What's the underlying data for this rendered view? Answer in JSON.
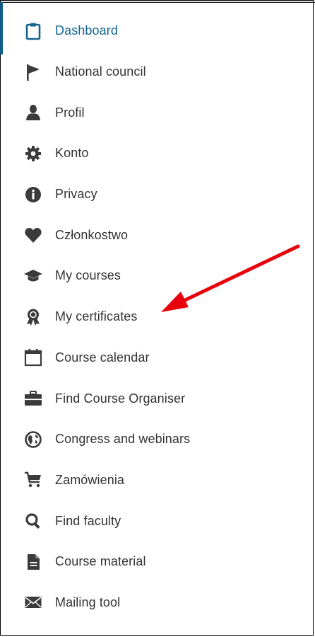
{
  "menu": {
    "items": [
      {
        "label": "Dashboard",
        "icon": "clipboard-icon",
        "active": true
      },
      {
        "label": "National council",
        "icon": "flag-icon"
      },
      {
        "label": "Profil",
        "icon": "user-icon"
      },
      {
        "label": "Konto",
        "icon": "gear-icon"
      },
      {
        "label": "Privacy",
        "icon": "info-icon"
      },
      {
        "label": "Członkostwo",
        "icon": "heart-icon"
      },
      {
        "label": "My courses",
        "icon": "graduation-cap-icon"
      },
      {
        "label": "My certificates",
        "icon": "award-icon"
      },
      {
        "label": "Course calendar",
        "icon": "calendar-icon"
      },
      {
        "label": "Find Course Organiser",
        "icon": "briefcase-icon"
      },
      {
        "label": "Congress and webinars",
        "icon": "globe-icon"
      },
      {
        "label": "Zamówienia",
        "icon": "cart-icon"
      },
      {
        "label": "Find faculty",
        "icon": "search-icon"
      },
      {
        "label": "Course material",
        "icon": "document-icon"
      },
      {
        "label": "Mailing tool",
        "icon": "envelope-icon"
      }
    ]
  },
  "colors": {
    "active": "#146591",
    "text": "#333333",
    "icon": "#3b3b3b",
    "arrow": "#e8000b"
  }
}
